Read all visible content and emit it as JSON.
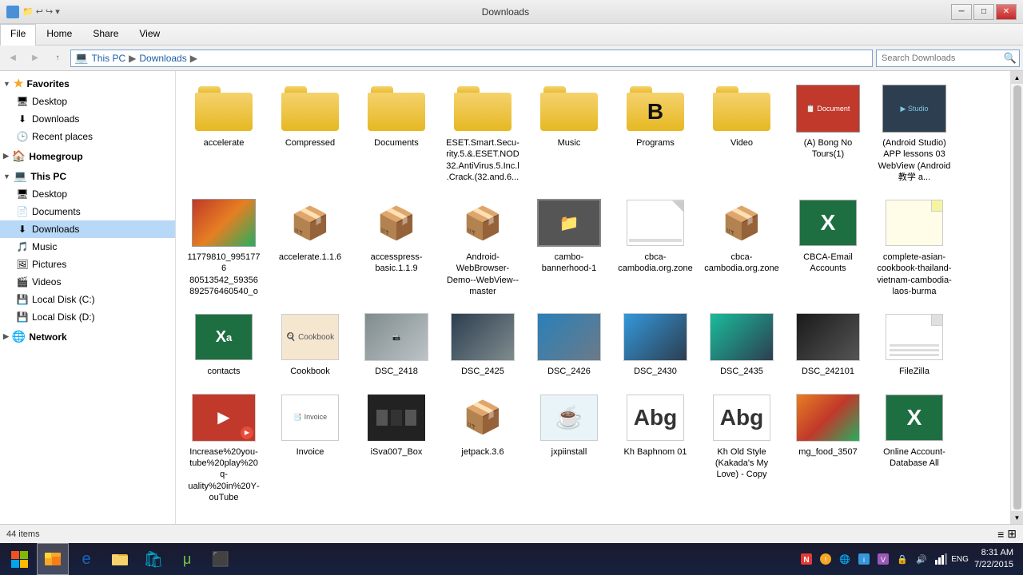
{
  "titleBar": {
    "title": "Downloads",
    "quickAccessLabel": "Quick Access",
    "minBtn": "─",
    "maxBtn": "□",
    "closeBtn": "✕"
  },
  "ribbon": {
    "tabs": [
      "File",
      "Home",
      "Share",
      "View"
    ],
    "activeTab": "Home"
  },
  "addressBar": {
    "back": "◀",
    "forward": "▶",
    "up": "↑",
    "path": [
      "This PC",
      "Downloads"
    ],
    "searchPlaceholder": "Search Downloads"
  },
  "sidebar": {
    "favorites": {
      "label": "Favorites",
      "items": [
        {
          "name": "Desktop",
          "icon": "desktop"
        },
        {
          "name": "Downloads",
          "icon": "downloads"
        },
        {
          "name": "Recent places",
          "icon": "recent"
        }
      ]
    },
    "homegroup": {
      "label": "Homegroup"
    },
    "thisPC": {
      "label": "This PC",
      "items": [
        {
          "name": "Desktop",
          "icon": "desktop"
        },
        {
          "name": "Documents",
          "icon": "documents"
        },
        {
          "name": "Downloads",
          "icon": "downloads",
          "active": true
        },
        {
          "name": "Music",
          "icon": "music"
        },
        {
          "name": "Pictures",
          "icon": "pictures"
        },
        {
          "name": "Videos",
          "icon": "videos"
        },
        {
          "name": "Local Disk (C:)",
          "icon": "disk"
        },
        {
          "name": "Local Disk (D:)",
          "icon": "disk"
        }
      ]
    },
    "network": {
      "label": "Network"
    }
  },
  "files": [
    {
      "name": "accelerate",
      "type": "folder"
    },
    {
      "name": "Compressed",
      "type": "folder"
    },
    {
      "name": "Documents",
      "type": "folder"
    },
    {
      "name": "ESET.Smart.Security.5.&.ESET.NOD32.AntiVirus.5.Inc.l.Crack.(32.and.6...",
      "type": "folder"
    },
    {
      "name": "Music",
      "type": "folder"
    },
    {
      "name": "Programs",
      "type": "folder-b"
    },
    {
      "name": "Video",
      "type": "folder"
    },
    {
      "name": "(A) Bong No Tours(1)",
      "type": "pdf-image"
    },
    {
      "name": "(Android Studio) APP lessons 03 WebView (Android教学 a...",
      "type": "screenshot"
    },
    {
      "name": "11779810_995177680513542_59356892576460540_o",
      "type": "food-photo"
    },
    {
      "name": "accelerate.1.1.6",
      "type": "zip"
    },
    {
      "name": "accesspress-basic.1.1.9",
      "type": "zip"
    },
    {
      "name": "Android-WebBrowser-Demo--WebView--master",
      "type": "zip"
    },
    {
      "name": "cambo-bannerhood-1",
      "type": "archive"
    },
    {
      "name": "cbca-cambodia.org.zone",
      "type": "doc"
    },
    {
      "name": "cbca-cambodia.org.zone",
      "type": "zip-doc"
    },
    {
      "name": "CBCA-Email Accounts",
      "type": "excel"
    },
    {
      "name": "complete-asian-cookbook-thailand-vietnam-cambodia-laos-burma",
      "type": "yellow-doc"
    },
    {
      "name": "contacts",
      "type": "excel-contact"
    },
    {
      "name": "Cookbook",
      "type": "pdf-cookbook"
    },
    {
      "name": "DSC_2418",
      "type": "photo-meeting"
    },
    {
      "name": "DSC_2425",
      "type": "photo-meeting"
    },
    {
      "name": "DSC_2426",
      "type": "photo-meeting"
    },
    {
      "name": "DSC_2430",
      "type": "photo-meeting"
    },
    {
      "name": "DSC_2435",
      "type": "photo-meeting"
    },
    {
      "name": "DSC_242101",
      "type": "photo-dark"
    },
    {
      "name": "FileZilla",
      "type": "doc-plain"
    },
    {
      "name": "Increase%20youtube%20play%20quality%20in%20YouTube",
      "type": "video-thumb"
    },
    {
      "name": "Invoice",
      "type": "pdf-invoice"
    },
    {
      "name": "iSva007_Box",
      "type": "box-icon"
    },
    {
      "name": "jetpack.3.6",
      "type": "zip2"
    },
    {
      "name": "jxpiinstall",
      "type": "java-exe"
    },
    {
      "name": "Kh Baphnom 01",
      "type": "font-abg"
    },
    {
      "name": "Kh Old Style (Kakada's My Love) - Copy",
      "type": "font-abg2"
    },
    {
      "name": "mg_food_3507",
      "type": "food-img"
    },
    {
      "name": "Online Account-Database All",
      "type": "excel2"
    }
  ],
  "statusBar": {
    "itemCount": "44 items"
  },
  "taskbar": {
    "time": "8:31 AM",
    "date": "7/22/2015",
    "language": "ENG"
  }
}
